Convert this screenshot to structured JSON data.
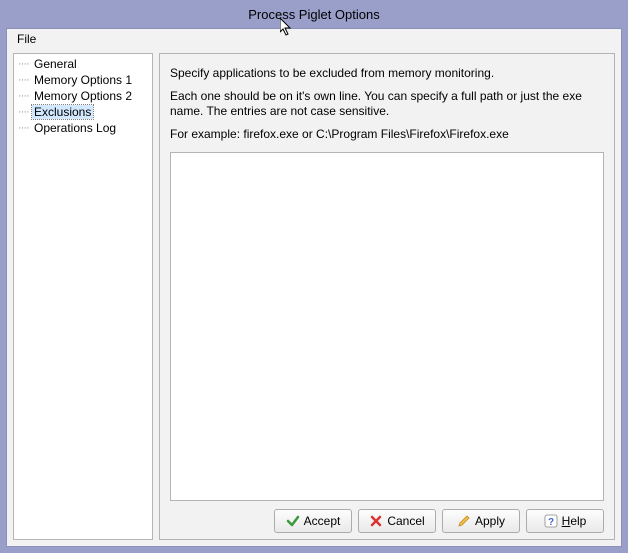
{
  "title": "Process Piglet Options",
  "menubar": {
    "file": "File"
  },
  "tree": {
    "items": [
      {
        "label": "General",
        "selected": false
      },
      {
        "label": "Memory Options 1",
        "selected": false
      },
      {
        "label": "Memory Options 2",
        "selected": false
      },
      {
        "label": "Exclusions",
        "selected": true
      },
      {
        "label": "Operations Log",
        "selected": false
      }
    ]
  },
  "panel": {
    "line1": "Specify applications to be excluded from memory monitoring.",
    "line2": "Each one should be on it's own line. You can specify a full path or just the exe name.  The entries are not case sensitive.",
    "line3": "For example: firefox.exe or C:\\Program Files\\Firefox\\Firefox.exe",
    "textarea_value": ""
  },
  "buttons": {
    "accept": "Accept",
    "cancel": "Cancel",
    "apply": "Apply",
    "help": "Help"
  }
}
